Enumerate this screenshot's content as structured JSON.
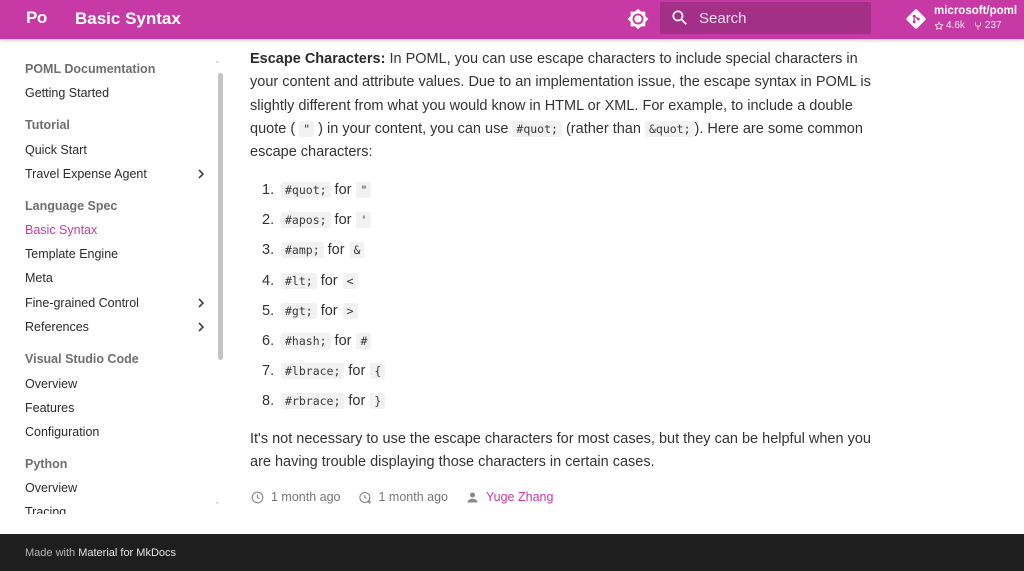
{
  "header": {
    "logo": "Po",
    "title": "Basic Syntax",
    "search_placeholder": "Search",
    "repo": {
      "name": "microsoft/poml",
      "stars": "4.6k",
      "forks": "237"
    }
  },
  "sidebar": {
    "sections": [
      {
        "title": "POML Documentation",
        "items": [
          {
            "label": "Getting Started"
          }
        ]
      },
      {
        "title": "Tutorial",
        "items": [
          {
            "label": "Quick Start"
          },
          {
            "label": "Travel Expense Agent"
          }
        ]
      },
      {
        "title": "Language Spec",
        "items": [
          {
            "label": "Basic Syntax"
          },
          {
            "label": "Template Engine"
          },
          {
            "label": "Meta"
          },
          {
            "label": "Fine-grained Control"
          },
          {
            "label": "References"
          }
        ]
      },
      {
        "title": "Visual Studio Code",
        "items": [
          {
            "label": "Overview"
          },
          {
            "label": "Features"
          },
          {
            "label": "Configuration"
          }
        ]
      },
      {
        "title": "Python",
        "items": [
          {
            "label": "Overview"
          },
          {
            "label": "Tracing"
          }
        ]
      }
    ],
    "active_item": "Basic Syntax"
  },
  "content": {
    "intro_strong": "Escape Characters:",
    "intro_1": " In POML, you can use escape characters to include special characters in your content and attribute values. Due to an implementation issue, the escape syntax in POML is slightly different from what you would know in HTML or XML. For example, to include a double quote (",
    "intro_quote_code": "\"",
    "intro_2": ") in your content, you can use ",
    "intro_code_1": "#quot;",
    "intro_3": " (rather than ",
    "intro_code_2": "&quot;",
    "intro_4": "). Here are some common escape characters:",
    "escapes": [
      {
        "num": "1.",
        "code": "#quot;",
        "for": "for",
        "char": "\""
      },
      {
        "num": "2.",
        "code": "#apos;",
        "for": "for",
        "char": "'"
      },
      {
        "num": "3.",
        "code": "#amp;",
        "for": "for",
        "char": "&"
      },
      {
        "num": "4.",
        "code": "#lt;",
        "for": "for",
        "char": "<"
      },
      {
        "num": "5.",
        "code": "#gt;",
        "for": "for",
        "char": ">"
      },
      {
        "num": "6.",
        "code": "#hash;",
        "for": "for",
        "char": "#"
      },
      {
        "num": "7.",
        "code": "#lbrace;",
        "for": "for",
        "char": "{"
      },
      {
        "num": "8.",
        "code": "#rbrace;",
        "for": "for",
        "char": "}"
      }
    ],
    "closing": "It's not necessary to use the escape characters for most cases, but they can be helpful when you are having trouble displaying those characters in certain cases.",
    "meta": {
      "updated": "1 month ago",
      "created": "1 month ago",
      "author": "Yuge Zhang"
    }
  },
  "footer": {
    "made_with": "Made with",
    "material": "Material for MkDocs"
  },
  "colors": {
    "primary": "#c73aa5",
    "footer_bg": "#1e1e1e"
  }
}
